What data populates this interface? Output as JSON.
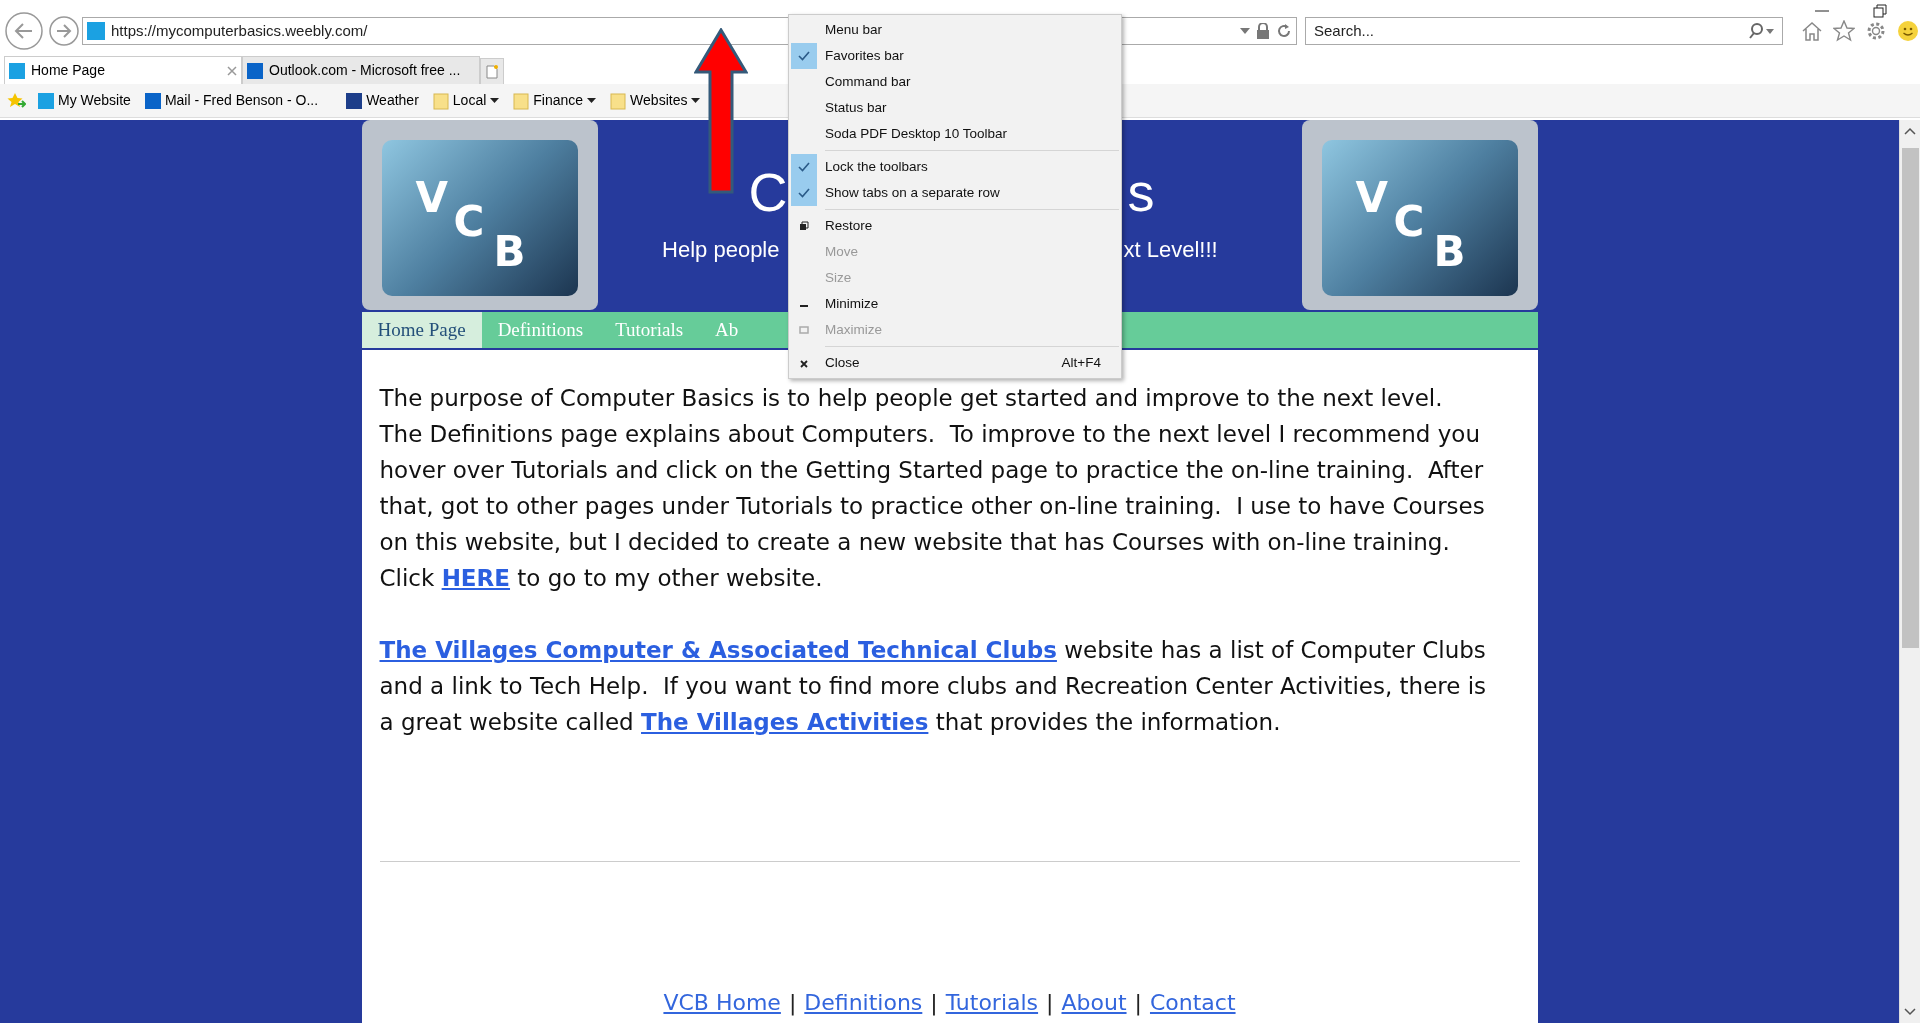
{
  "browser": {
    "address": "https://mycomputerbasics.weebly.com/",
    "search": {
      "placeholder": "Search..."
    },
    "tabs": [
      {
        "label": "Home Page",
        "selected": true
      },
      {
        "label": "Outlook.com - Microsoft free ...",
        "selected": false
      }
    ],
    "favorites": [
      {
        "label": "My Website",
        "kind": "site",
        "dropdown": false
      },
      {
        "label": "Mail - Fred Benson - O...",
        "kind": "mail",
        "dropdown": false
      },
      {
        "label": "Weather",
        "kind": "weather",
        "dropdown": false
      },
      {
        "label": "Local",
        "kind": "folder",
        "dropdown": true
      },
      {
        "label": "Finance",
        "kind": "folder",
        "dropdown": true
      },
      {
        "label": "Websites",
        "kind": "folder",
        "dropdown": true
      }
    ]
  },
  "site": {
    "logos": [
      {
        "letters": [
          "V",
          "C",
          "B"
        ]
      },
      {
        "letters": [
          "V",
          "C",
          "B"
        ]
      }
    ],
    "title_parts": [
      "C",
      "s"
    ],
    "subtitle_parts": [
      "Help people",
      "xt Level!!!"
    ],
    "nav": [
      {
        "label": "Home Page",
        "selected": true
      },
      {
        "label": "Definitions",
        "selected": false
      },
      {
        "label": "Tutorials",
        "selected": false
      },
      {
        "label": "Ab",
        "selected": false
      }
    ],
    "paragraphs": [
      [
        {
          "text": "The purpose of Computer Basics is to help people get started and improve to the next level.  The Definitions page explains about Computers.  To improve to the next level I recommend you hover over Tutorials and click on the Getting Started page to practice the on-line training.  After that, got to other pages under Tutorials to practice other on-line training.  I use to have Courses on this website, but I decided to create a new website that has Courses with on-line training.  Click ",
          "link": false
        },
        {
          "text": "HERE",
          "link": true
        },
        {
          "text": " to go to my other website.",
          "link": false
        }
      ],
      [
        {
          "text": "The Villages Computer & Associated Technical Clubs",
          "link": true
        },
        {
          "text": " website has a list of Computer Clubs and a link to Tech Help.  If you want to find more clubs and Recreation Center Activities, there is a great website called ",
          "link": false
        },
        {
          "text": "The Villages Activities",
          "link": true
        },
        {
          "text": " that provides the information.",
          "link": false
        }
      ]
    ],
    "footer": [
      {
        "text": "VCB Home",
        "kind": "link"
      },
      {
        "text": "|",
        "kind": "separator"
      },
      {
        "text": "Definitions",
        "kind": "link"
      },
      {
        "text": "|",
        "kind": "separator"
      },
      {
        "text": "Tutorials",
        "kind": "link"
      },
      {
        "text": "|",
        "kind": "separator"
      },
      {
        "text": "About",
        "kind": "link"
      },
      {
        "text": "|",
        "kind": "separator"
      },
      {
        "text": "Contact",
        "kind": "link"
      }
    ]
  },
  "context_menu": {
    "groups": [
      [
        {
          "label": "Menu bar",
          "kind": "check",
          "checked": false,
          "disabled": false
        },
        {
          "label": "Favorites bar",
          "kind": "check",
          "checked": true,
          "disabled": false
        },
        {
          "label": "Command bar",
          "kind": "check",
          "checked": false,
          "disabled": false
        },
        {
          "label": "Status bar",
          "kind": "check",
          "checked": false,
          "disabled": false
        },
        {
          "label": "Soda PDF Desktop 10 Toolbar",
          "kind": "check",
          "checked": false,
          "disabled": false
        }
      ],
      [
        {
          "label": "Lock the toolbars",
          "kind": "check",
          "checked": true,
          "disabled": false
        },
        {
          "label": "Show tabs on a separate row",
          "kind": "check",
          "checked": true,
          "disabled": false
        }
      ],
      [
        {
          "label": "Restore",
          "kind": "restore",
          "disabled": false
        },
        {
          "label": "Move",
          "kind": "plain",
          "disabled": true
        },
        {
          "label": "Size",
          "kind": "plain",
          "disabled": true
        },
        {
          "label": "Minimize",
          "kind": "minimize",
          "disabled": false
        },
        {
          "label": "Maximize",
          "kind": "maximize",
          "disabled": true
        }
      ],
      [
        {
          "label": "Close",
          "kind": "close",
          "shortcut": "Alt+F4",
          "disabled": false
        }
      ]
    ]
  }
}
